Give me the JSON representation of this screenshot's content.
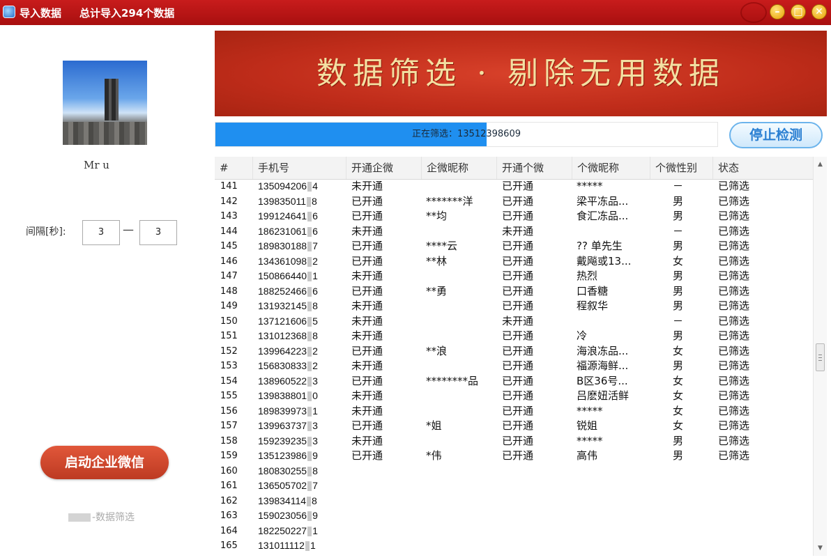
{
  "window": {
    "title": "导入数据",
    "subtitle": "总计导入294个数据",
    "controls": {
      "minimize": "–",
      "maximize": "□",
      "close": "✕"
    }
  },
  "sidebar": {
    "username": "Mr  u",
    "interval_label": "间隔[秒]:",
    "interval_min": "3",
    "interval_max": "3",
    "interval_separator": "—",
    "launch_button": "启动企业微信",
    "footer": "-数据筛选"
  },
  "banner": {
    "text": "数据筛选 · 剔除无用数据"
  },
  "progress": {
    "text": "正在筛选：13512398609",
    "fraction": 0.54
  },
  "stop_button": "停止检测",
  "table": {
    "columns": [
      "#",
      "手机号",
      "开通企微",
      "企微昵称",
      "开通个微",
      "个微昵称",
      "个微性别",
      "状态"
    ],
    "rows": [
      [
        "141",
        "1350942064",
        "未开通",
        "",
        "已开通",
        "*****",
        "－",
        "已筛选"
      ],
      [
        "142",
        "1398350118",
        "已开通",
        "*******洋",
        "已开通",
        "梁平冻品...",
        "男",
        "已筛选"
      ],
      [
        "143",
        "1991246416",
        "已开通",
        "**均",
        "已开通",
        "食汇冻品...",
        "男",
        "已筛选"
      ],
      [
        "144",
        "1862310616",
        "未开通",
        "",
        "未开通",
        "",
        "－",
        "已筛选"
      ],
      [
        "145",
        "1898301887",
        "已开通",
        "****云",
        "已开通",
        "?? 单先生",
        "男",
        "已筛选"
      ],
      [
        "146",
        "1343610982",
        "已开通",
        "**林",
        "已开通",
        "戴飚或13...",
        "女",
        "已筛选"
      ],
      [
        "147",
        "1508664401",
        "未开通",
        "",
        "已开通",
        "热烈",
        "男",
        "已筛选"
      ],
      [
        "148",
        "1882524666",
        "已开通",
        "**勇",
        "已开通",
        "口香糖",
        "男",
        "已筛选"
      ],
      [
        "149",
        "1319321458",
        "未开通",
        "",
        "已开通",
        "程叙华",
        "男",
        "已筛选"
      ],
      [
        "150",
        "1371216065",
        "未开通",
        "",
        "未开通",
        "",
        "－",
        "已筛选"
      ],
      [
        "151",
        "1310123688",
        "未开通",
        "",
        "已开通",
        "冷",
        "男",
        "已筛选"
      ],
      [
        "152",
        "1399642232",
        "已开通",
        "**浪",
        "已开通",
        "海浪冻品...",
        "女",
        "已筛选"
      ],
      [
        "153",
        "1568308332",
        "未开通",
        "",
        "已开通",
        "福源海鲜...",
        "男",
        "已筛选"
      ],
      [
        "154",
        "1389605223",
        "已开通",
        "********品",
        "已开通",
        "B区36号...",
        "女",
        "已筛选"
      ],
      [
        "155",
        "1398388010",
        "未开通",
        "",
        "已开通",
        "吕麽妞活鲜",
        "女",
        "已筛选"
      ],
      [
        "156",
        "1898399731",
        "未开通",
        "",
        "已开通",
        "*****",
        "女",
        "已筛选"
      ],
      [
        "157",
        "1399637373",
        "已开通",
        "*姐",
        "已开通",
        "锐姐",
        "女",
        "已筛选"
      ],
      [
        "158",
        "1592392353",
        "未开通",
        "",
        "已开通",
        "*****",
        "男",
        "已筛选"
      ],
      [
        "159",
        "1351239869",
        "已开通",
        "*伟",
        "已开通",
        "高伟",
        "男",
        "已筛选"
      ],
      [
        "160",
        "1808302558",
        "",
        "",
        "",
        "",
        "",
        ""
      ],
      [
        "161",
        "1365057027",
        "",
        "",
        "",
        "",
        "",
        ""
      ],
      [
        "162",
        "1398341148",
        "",
        "",
        "",
        "",
        "",
        ""
      ],
      [
        "163",
        "1590230569",
        "",
        "",
        "",
        "",
        "",
        ""
      ],
      [
        "164",
        "1822502271",
        "",
        "",
        "",
        "",
        "",
        ""
      ],
      [
        "165",
        "1310111121",
        "",
        "",
        "",
        "",
        "",
        ""
      ]
    ]
  }
}
